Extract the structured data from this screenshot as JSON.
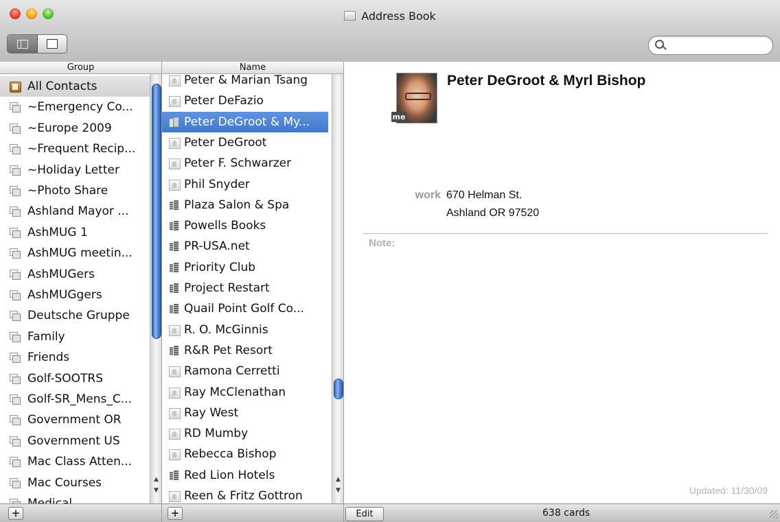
{
  "window": {
    "title": "Address Book"
  },
  "search": {
    "value": "",
    "placeholder": ""
  },
  "columns": {
    "group_header": "Group",
    "name_header": "Name"
  },
  "groups": [
    {
      "label": "All Contacts",
      "icon": "all-contacts-icon",
      "selected": true
    },
    {
      "label": "~Emergency Co...",
      "icon": "group-icon"
    },
    {
      "label": "~Europe 2009",
      "icon": "group-icon"
    },
    {
      "label": "~Frequent Recip...",
      "icon": "group-icon"
    },
    {
      "label": "~Holiday Letter",
      "icon": "group-icon"
    },
    {
      "label": "~Photo Share",
      "icon": "group-icon"
    },
    {
      "label": "Ashland Mayor ...",
      "icon": "group-icon"
    },
    {
      "label": "AshMUG 1",
      "icon": "group-icon"
    },
    {
      "label": "AshMUG meetin...",
      "icon": "group-icon"
    },
    {
      "label": "AshMUGers",
      "icon": "group-icon"
    },
    {
      "label": "AshMUGgers",
      "icon": "group-icon"
    },
    {
      "label": "Deutsche Gruppe",
      "icon": "group-icon"
    },
    {
      "label": "Family",
      "icon": "group-icon"
    },
    {
      "label": "Friends",
      "icon": "group-icon"
    },
    {
      "label": "Golf-SOOTRS",
      "icon": "group-icon"
    },
    {
      "label": "Golf-SR_Mens_C...",
      "icon": "group-icon"
    },
    {
      "label": "Government OR",
      "icon": "group-icon"
    },
    {
      "label": "Government US",
      "icon": "group-icon"
    },
    {
      "label": "Mac Class Atten...",
      "icon": "group-icon"
    },
    {
      "label": "Mac Courses",
      "icon": "group-icon"
    },
    {
      "label": "Medical",
      "icon": "group-icon"
    }
  ],
  "names": [
    {
      "label": "Peter & Marian Tsang",
      "type": "person"
    },
    {
      "label": "Peter DeFazio",
      "type": "person"
    },
    {
      "label": "Peter DeGroot & My...",
      "type": "company",
      "selected": true
    },
    {
      "label": "Peter DeGroot",
      "type": "person"
    },
    {
      "label": "Peter F. Schwarzer",
      "type": "person"
    },
    {
      "label": "Phil Snyder",
      "type": "person"
    },
    {
      "label": "Plaza Salon & Spa",
      "type": "company"
    },
    {
      "label": "Powells Books",
      "type": "company"
    },
    {
      "label": "PR-USA.net",
      "type": "company"
    },
    {
      "label": "Priority Club",
      "type": "company"
    },
    {
      "label": "Project Restart",
      "type": "company"
    },
    {
      "label": "Quail Point Golf Co...",
      "type": "company"
    },
    {
      "label": "R. O. McGinnis",
      "type": "person"
    },
    {
      "label": "R&R Pet Resort",
      "type": "company"
    },
    {
      "label": "Ramona Cerretti",
      "type": "person"
    },
    {
      "label": "Ray McClenathan",
      "type": "person"
    },
    {
      "label": "Ray West",
      "type": "person"
    },
    {
      "label": "RD Mumby",
      "type": "person"
    },
    {
      "label": "Rebecca Bishop",
      "type": "person"
    },
    {
      "label": "Red Lion Hotels",
      "type": "company"
    },
    {
      "label": "Reen & Fritz Gottron",
      "type": "person"
    }
  ],
  "card": {
    "name": "Peter DeGroot & Myrl Bishop",
    "me_badge": "me",
    "address_label": "work",
    "address_line1": "670 Helman St.",
    "address_line2": "Ashland OR 97520",
    "note_label": "Note:",
    "updated": "Updated: 11/30/09"
  },
  "bottom": {
    "add_group": "+",
    "add_contact": "+",
    "edit": "Edit",
    "count": "638 cards"
  },
  "colors": {
    "selection_blue": "#3f79cf",
    "scroll_thumb": "#5c90dc"
  }
}
